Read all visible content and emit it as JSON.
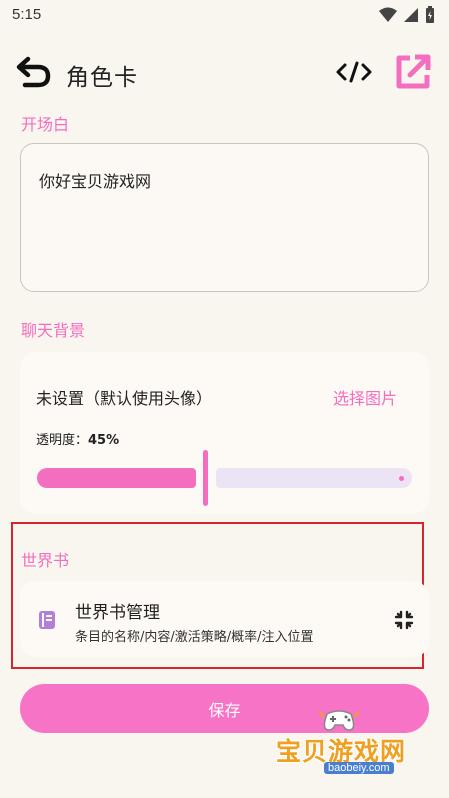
{
  "status_bar": {
    "time": "5:15"
  },
  "app_bar": {
    "title": "角色卡"
  },
  "greeting": {
    "label": "开场白",
    "value": "你好宝贝游戏网"
  },
  "chat_background": {
    "label": "聊天背景",
    "status": "未设置（默认使用头像）",
    "choose_label": "选择图片",
    "opacity_label": "透明度：",
    "opacity_value": "45%",
    "opacity_fraction": 0.45
  },
  "world_book": {
    "label": "世界书",
    "title": "世界书管理",
    "subtitle": "条目的名称/内容/激活策略/概率/注入位置"
  },
  "save_button": {
    "label": "保存"
  },
  "watermark": {
    "text": "宝贝游戏网",
    "url": "baobeiy.com"
  },
  "colors": {
    "accent": "#f46ec0",
    "background": "#f9f5ef",
    "slider_track": "#ece3f4",
    "highlight": "#d8242c"
  },
  "icons": {
    "back": "back-arrow-icon",
    "code": "code-icon",
    "export": "export-icon",
    "book": "book-icon",
    "expand": "expand-icon"
  }
}
